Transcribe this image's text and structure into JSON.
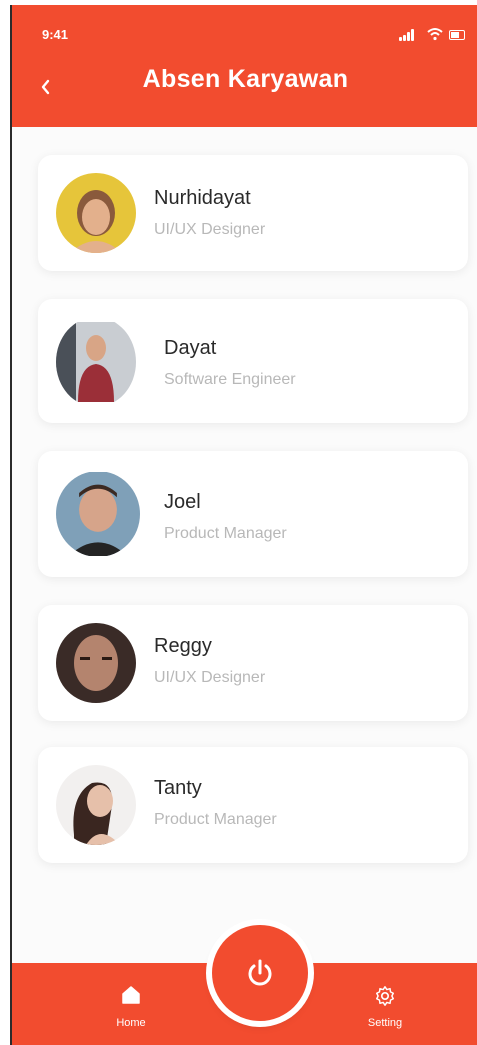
{
  "status_bar": {
    "time": "9:41"
  },
  "header": {
    "title": "Absen Karyawan"
  },
  "employees": [
    {
      "name": "Nurhidayat",
      "role": "UI/UX Designer"
    },
    {
      "name": "Dayat",
      "role": "Software Engineer"
    },
    {
      "name": "Joel",
      "role": "Product Manager"
    },
    {
      "name": "Reggy",
      "role": "UI/UX Designer"
    },
    {
      "name": "Tanty",
      "role": "Product Manager"
    }
  ],
  "nav": {
    "home_label": "Home",
    "setting_label": "Setting"
  },
  "icons": {
    "back": "chevron-left-icon",
    "home": "home-icon",
    "setting": "gear-icon",
    "power": "power-icon"
  },
  "colors": {
    "accent": "#f24c2f",
    "card_bg": "#ffffff",
    "muted_text": "#b8b8b8"
  }
}
